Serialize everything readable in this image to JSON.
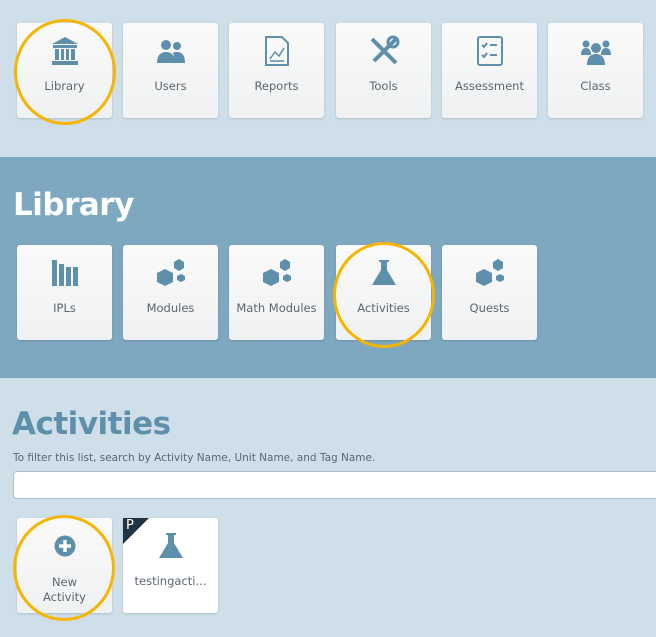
{
  "top_nav": [
    {
      "label": "Library",
      "icon": "library-icon"
    },
    {
      "label": "Users",
      "icon": "users-icon"
    },
    {
      "label": "Reports",
      "icon": "reports-icon"
    },
    {
      "label": "Tools",
      "icon": "tools-icon"
    },
    {
      "label": "Assessment",
      "icon": "assessment-icon"
    },
    {
      "label": "Class",
      "icon": "class-icon"
    }
  ],
  "library": {
    "title": "Library",
    "items": [
      {
        "label": "IPLs",
        "icon": "books-icon"
      },
      {
        "label": "Modules",
        "icon": "modules-icon"
      },
      {
        "label": "Math Modules",
        "icon": "modules-icon"
      },
      {
        "label": "Activities",
        "icon": "flask-icon"
      },
      {
        "label": "Quests",
        "icon": "modules-icon"
      }
    ]
  },
  "activities": {
    "title": "Activities",
    "filter_hint": "To filter this list, search by Activity Name, Unit Name, and Tag Name.",
    "filter_value": "",
    "new_label": "New Activity",
    "items": [
      {
        "label": "testingacti...",
        "badge": "P",
        "icon": "flask-icon"
      }
    ]
  },
  "colors": {
    "icon": "#5e8fab",
    "highlight": "#f6b500",
    "library_band": "#7ea8c0",
    "background": "#cfdfe9",
    "badge": "#1f3545"
  }
}
